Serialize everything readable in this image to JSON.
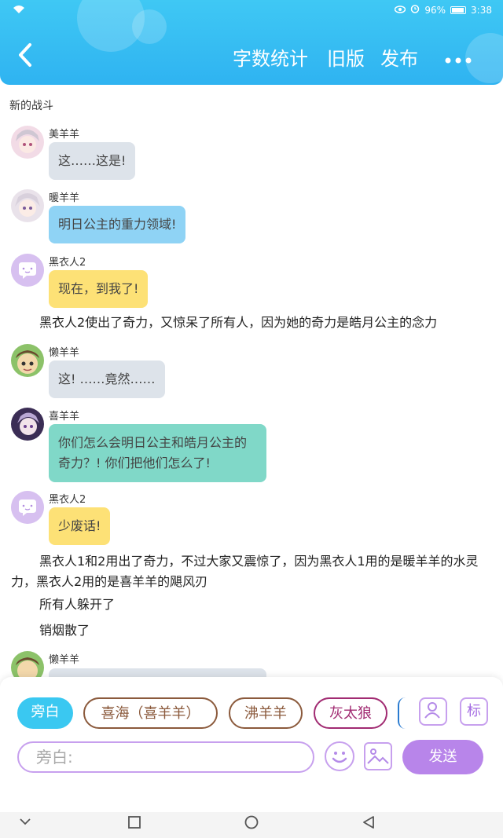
{
  "status": {
    "battery": "96%",
    "time": "3:38"
  },
  "header": {
    "word_count": "字数统计",
    "old_version": "旧版",
    "publish": "发布"
  },
  "story_title": "新的战斗",
  "messages": [
    {
      "name": "美羊羊",
      "text": "这……这是!"
    },
    {
      "name": "暖羊羊",
      "text": "明日公主的重力领域!"
    },
    {
      "name": "黑衣人2",
      "text": "现在，到我了!"
    },
    {
      "narration": "黑衣人2使出了奇力，又惊呆了所有人，因为她的奇力是皓月公主的念力"
    },
    {
      "name": "懒羊羊",
      "text": "这! ……竟然……"
    },
    {
      "name": "喜羊羊",
      "text": "你们怎么会明日公主和皓月公主的奇力？! 你们把他们怎么了!"
    },
    {
      "name": "黑衣人2",
      "text": "少废话!"
    },
    {
      "narration": "黑衣人1和2用出了奇力，不过大家又震惊了，因为黑衣人1用的是暖羊羊的水灵力，黑衣人2用的是喜羊羊的飓风刃"
    },
    {
      "narration": "所有人躲开了"
    },
    {
      "narration": "销烟散了"
    },
    {
      "name": "懒羊羊",
      "text": ""
    }
  ],
  "roles": [
    "旁白",
    "喜海（喜羊羊）",
    "沸羊羊",
    "灰太狼"
  ],
  "toolbar": {
    "tag_label": "标",
    "input_placeholder": "旁白:",
    "send_label": "发送"
  },
  "colors": {
    "header": "#2fb3f1",
    "bubble_gray": "#dde3ea",
    "bubble_blue": "#8fd3f5",
    "bubble_yellow": "#fde176",
    "bubble_teal": "#80d8c8",
    "accent_purple": "#b885ea"
  }
}
